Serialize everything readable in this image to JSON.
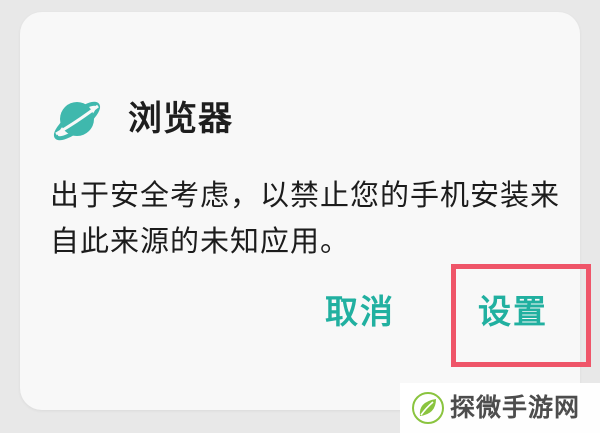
{
  "dialog": {
    "title": "浏览器",
    "message": "出于安全考虑，以禁止您的手机安装来自此来源的未知应用。",
    "buttons": {
      "cancel": "取消",
      "settings": "设置"
    }
  },
  "watermark": {
    "text": "探微手游网"
  },
  "colors": {
    "accent": "#21b0a0",
    "highlight": "#ef5569",
    "icon": "#3fb8ad"
  },
  "icons": {
    "app": "planet-icon",
    "watermark": "leaf-logo-icon"
  }
}
